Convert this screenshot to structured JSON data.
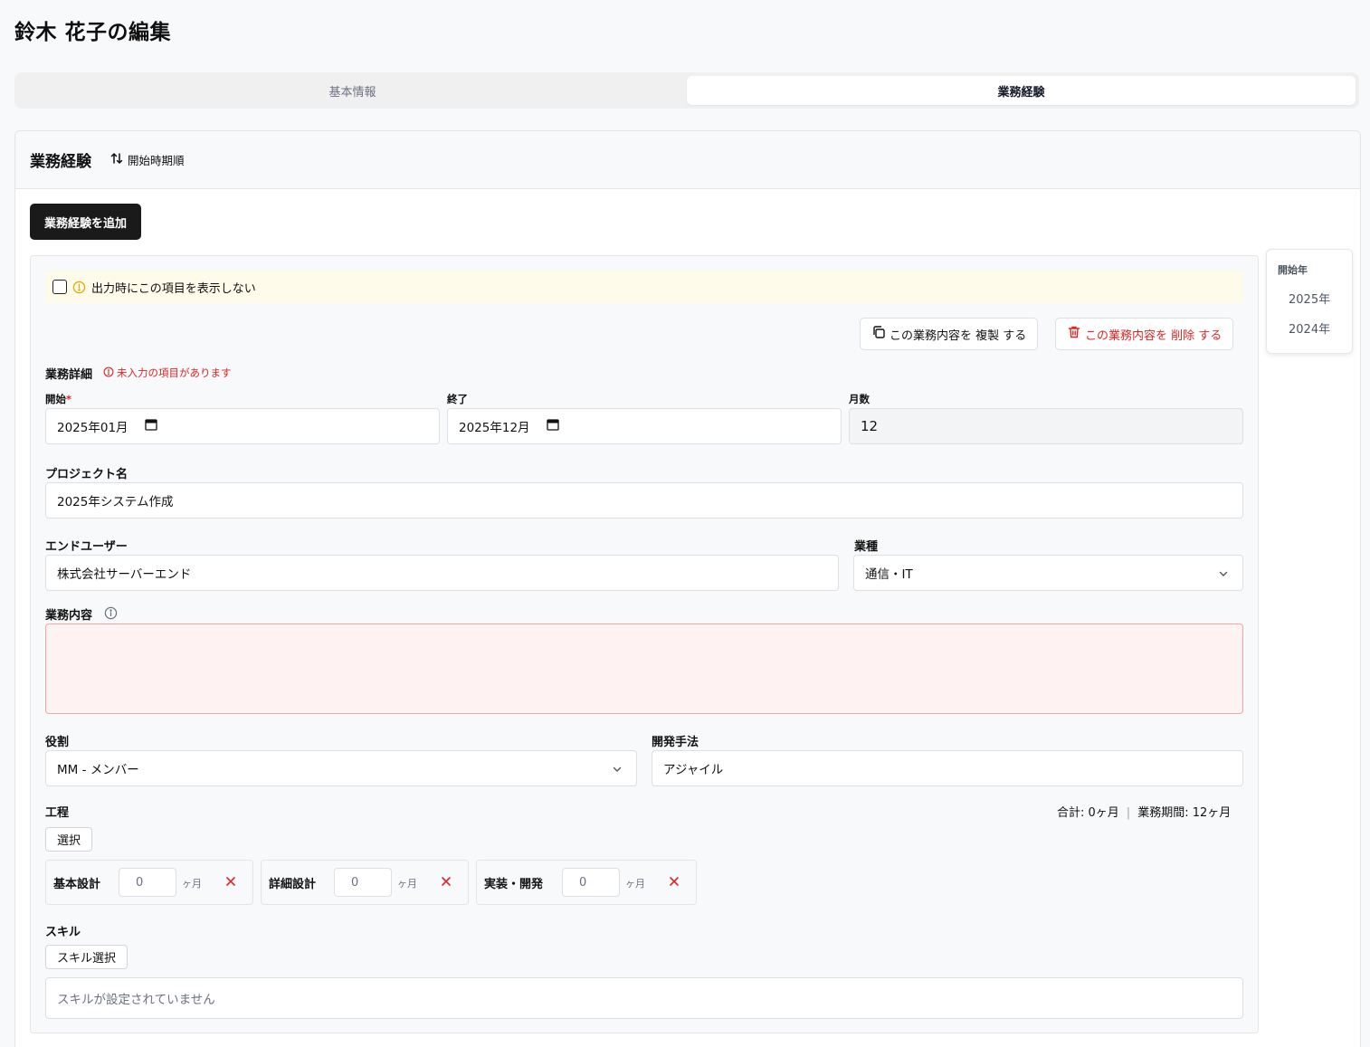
{
  "page": {
    "title": "鈴木 花子の編集"
  },
  "tabs": [
    {
      "label": "基本情報",
      "active": false
    },
    {
      "label": "業務経験",
      "active": true
    }
  ],
  "section": {
    "title": "業務経験",
    "sort_label": "開始時期順",
    "add_button": "業務経験を追加"
  },
  "entry": {
    "hide_label": "出力時にこの項目を表示しない",
    "hide_checked": false,
    "copy_button": "この業務内容を 複製 する",
    "delete_button": "この業務内容を 削除 する",
    "details_label": "業務詳細",
    "details_error": "未入力の項目があります",
    "start": {
      "label": "開始",
      "required_mark": "*",
      "value": "2025年01月"
    },
    "end": {
      "label": "終了",
      "value": "2025年12月"
    },
    "months": {
      "label": "月数",
      "value": "12"
    },
    "project": {
      "label": "プロジェクト名",
      "value": "2025年システム作成"
    },
    "end_user": {
      "label": "エンドユーザー",
      "value": "株式会社サーバーエンド"
    },
    "industry": {
      "label": "業種",
      "value": "通信・IT"
    },
    "work_content": {
      "label": "業務内容",
      "value": ""
    },
    "role": {
      "label": "役割",
      "value": "MM - メンバー"
    },
    "method": {
      "label": "開発手法",
      "value": "アジャイル"
    },
    "process": {
      "label": "工程",
      "select_button": "選択",
      "total": "合計: 0ヶ月",
      "separator": "|",
      "period": "業務期間: 12ヶ月",
      "items": [
        {
          "name": "基本設計",
          "value": "0",
          "unit": "ヶ月"
        },
        {
          "name": "詳細設計",
          "value": "0",
          "unit": "ヶ月"
        },
        {
          "name": "実装・開発",
          "value": "0",
          "unit": "ヶ月"
        }
      ]
    },
    "skills": {
      "label": "スキル",
      "select_button": "スキル選択",
      "empty_text": "スキルが設定されていません"
    }
  },
  "year_nav": {
    "title": "開始年",
    "years": [
      "2025年",
      "2024年"
    ]
  },
  "colors": {
    "accent_dark": "#1a1a1a",
    "error": "#dc2626",
    "warning_bg": "#fffbea",
    "error_bg": "#fef2f2"
  }
}
